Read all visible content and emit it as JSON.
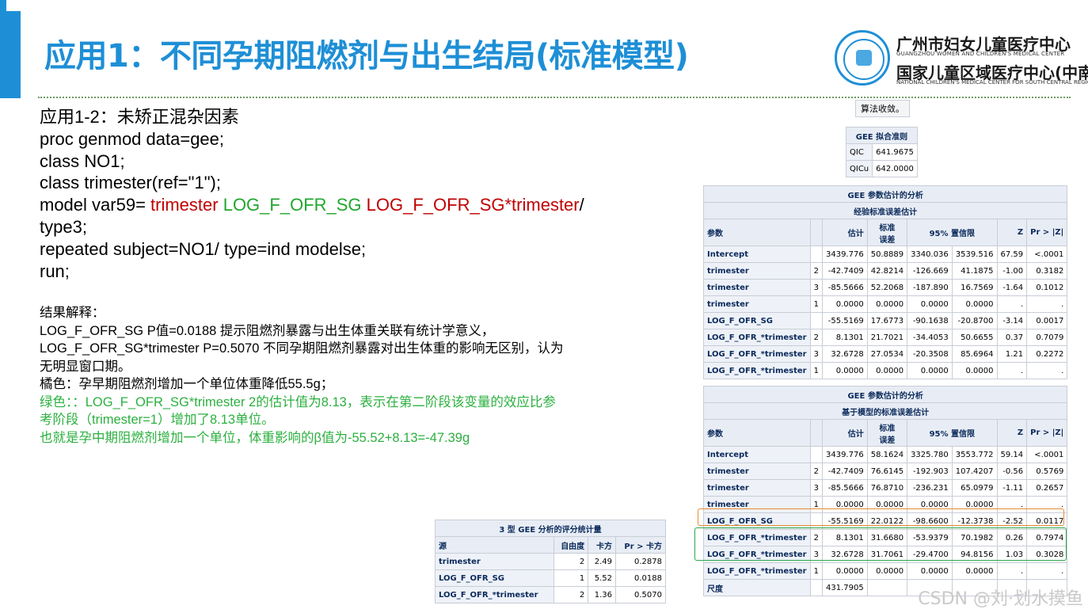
{
  "title": "应用1：不同孕期阻燃剂与出生结局(标准模型)",
  "logo": {
    "line1": "广州市妇女儿童医疗中心",
    "sub1": "GUANGZHOU WOMEN AND CHILDREN'S MEDICAL CENTER",
    "line2": "国家儿童区域医疗中心(中南)",
    "sub2": "NATIONAL CHILDREN'S MEDICAL CENTER FOR SOUTH CENTRAL REGION"
  },
  "code": {
    "line1": "应用1-2：未矫正混杂因素",
    "line2": "proc genmod data=gee;",
    "line3": "class NO1;",
    "line4": "class trimester(ref=\"1\");",
    "line5_a": "model var59= ",
    "line5_b": "trimester",
    "line5_c": " LOG_F_OFR_SG",
    "line5_d": "  LOG_F_OFR_SG",
    "line5_e": "*trimester",
    "line5_f": "/",
    "line6": "type3;",
    "line7": "repeated subject=NO1/ type=ind modelse;",
    "line8": "run;"
  },
  "explain": {
    "l1": "结果解释：",
    "l2": "LOG_F_OFR_SG P值=0.0188 提示阻燃剂暴露与出生体重关联有统计学意义，",
    "l3": "LOG_F_OFR_SG*trimester P=0.5070 不同孕期阻燃剂暴露对出生体重的影响无区别，认为",
    "l4": "无明显窗口期。",
    "l5": "橘色：孕早期阻燃剂增加一个单位体重降低55.5g；",
    "l6": "绿色：：LOG_F_OFR_SG*trimester 2的估计值为8.13，表示在第二阶段该变量的效应比参",
    "l7": "考阶段（trimester=1）增加了8.13单位。",
    "l8": "也就是孕中期阻燃剂增加一个单位，体重影响的β值为-55.52+8.13=-47.39g"
  },
  "convergence": "算法收敛。",
  "fit": {
    "caption": "GEE 拟合准则",
    "rows": [
      {
        "label": "QIC",
        "value": "641.9675"
      },
      {
        "label": "QICu",
        "value": "642.0000"
      }
    ]
  },
  "est_headers": {
    "param": "参数",
    "estimate": "估计",
    "stderr_1": "标准",
    "stderr_2": "误差",
    "ci": "95% 置信限",
    "z": "Z",
    "p": "Pr > |Z|"
  },
  "est1": {
    "caption1": "GEE 参数估计的分析",
    "caption2": "经验标准误差估计",
    "rows": [
      {
        "param": "Intercept",
        "lvl": "",
        "est": "3439.776",
        "se": "50.8889",
        "lo": "3340.036",
        "hi": "3539.516",
        "z": "67.59",
        "p": "<.0001"
      },
      {
        "param": "trimester",
        "lvl": "2",
        "est": "-42.7409",
        "se": "42.8214",
        "lo": "-126.669",
        "hi": "41.1875",
        "z": "-1.00",
        "p": "0.3182"
      },
      {
        "param": "trimester",
        "lvl": "3",
        "est": "-85.5666",
        "se": "52.2068",
        "lo": "-187.890",
        "hi": "16.7569",
        "z": "-1.64",
        "p": "0.1012"
      },
      {
        "param": "trimester",
        "lvl": "1",
        "est": "0.0000",
        "se": "0.0000",
        "lo": "0.0000",
        "hi": "0.0000",
        "z": ".",
        "p": "."
      },
      {
        "param": "LOG_F_OFR_SG",
        "lvl": "",
        "est": "-55.5169",
        "se": "17.6773",
        "lo": "-90.1638",
        "hi": "-20.8700",
        "z": "-3.14",
        "p": "0.0017"
      },
      {
        "param": "LOG_F_OFR_*trimester",
        "lvl": "2",
        "est": "8.1301",
        "se": "21.7021",
        "lo": "-34.4053",
        "hi": "50.6655",
        "z": "0.37",
        "p": "0.7079"
      },
      {
        "param": "LOG_F_OFR_*trimester",
        "lvl": "3",
        "est": "32.6728",
        "se": "27.0534",
        "lo": "-20.3508",
        "hi": "85.6964",
        "z": "1.21",
        "p": "0.2272"
      },
      {
        "param": "LOG_F_OFR_*trimester",
        "lvl": "1",
        "est": "0.0000",
        "se": "0.0000",
        "lo": "0.0000",
        "hi": "0.0000",
        "z": ".",
        "p": "."
      }
    ]
  },
  "est2": {
    "caption1": "GEE 参数估计的分析",
    "caption2": "基于模型的标准误差估计",
    "rows": [
      {
        "param": "Intercept",
        "lvl": "",
        "est": "3439.776",
        "se": "58.1624",
        "lo": "3325.780",
        "hi": "3553.772",
        "z": "59.14",
        "p": "<.0001"
      },
      {
        "param": "trimester",
        "lvl": "2",
        "est": "-42.7409",
        "se": "76.6145",
        "lo": "-192.903",
        "hi": "107.4207",
        "z": "-0.56",
        "p": "0.5769"
      },
      {
        "param": "trimester",
        "lvl": "3",
        "est": "-85.5666",
        "se": "76.8710",
        "lo": "-236.231",
        "hi": "65.0979",
        "z": "-1.11",
        "p": "0.2657"
      },
      {
        "param": "trimester",
        "lvl": "1",
        "est": "0.0000",
        "se": "0.0000",
        "lo": "0.0000",
        "hi": "0.0000",
        "z": ".",
        "p": "."
      },
      {
        "param": "LOG_F_OFR_SG",
        "lvl": "",
        "est": "-55.5169",
        "se": "22.0122",
        "lo": "-98.6600",
        "hi": "-12.3738",
        "z": "-2.52",
        "p": "0.0117"
      },
      {
        "param": "LOG_F_OFR_*trimester",
        "lvl": "2",
        "est": "8.1301",
        "se": "31.6680",
        "lo": "-53.9379",
        "hi": "70.1982",
        "z": "0.26",
        "p": "0.7974"
      },
      {
        "param": "LOG_F_OFR_*trimester",
        "lvl": "3",
        "est": "32.6728",
        "se": "31.7061",
        "lo": "-29.4700",
        "hi": "94.8156",
        "z": "1.03",
        "p": "0.3028"
      },
      {
        "param": "LOG_F_OFR_*trimester",
        "lvl": "1",
        "est": "0.0000",
        "se": "0.0000",
        "lo": "0.0000",
        "hi": "0.0000",
        "z": ".",
        "p": "."
      },
      {
        "param": "尺度",
        "lvl": "",
        "est": "431.7905",
        "se": "",
        "lo": "",
        "hi": "",
        "z": "",
        "p": ""
      }
    ]
  },
  "score": {
    "caption": "3 型 GEE 分析的评分统计量",
    "headers": {
      "source": "源",
      "df": "自由度",
      "chisq": "卡方",
      "p": "Pr > 卡方"
    },
    "rows": [
      {
        "source": "trimester",
        "df": "2",
        "chisq": "2.49",
        "p": "0.2878"
      },
      {
        "source": "LOG_F_OFR_SG",
        "df": "1",
        "chisq": "5.52",
        "p": "0.0188"
      },
      {
        "source": "LOG_F_OFR_*trimester",
        "df": "2",
        "chisq": "1.36",
        "p": "0.5070"
      }
    ]
  },
  "watermark": "CSDN @刘·划水摸鱼",
  "colors": {
    "title_blue": "#1e8fd6",
    "code_red": "#c00000",
    "code_green": "#22a62f",
    "highlight_orange": "#e78a36",
    "highlight_green": "#2aa84a"
  }
}
